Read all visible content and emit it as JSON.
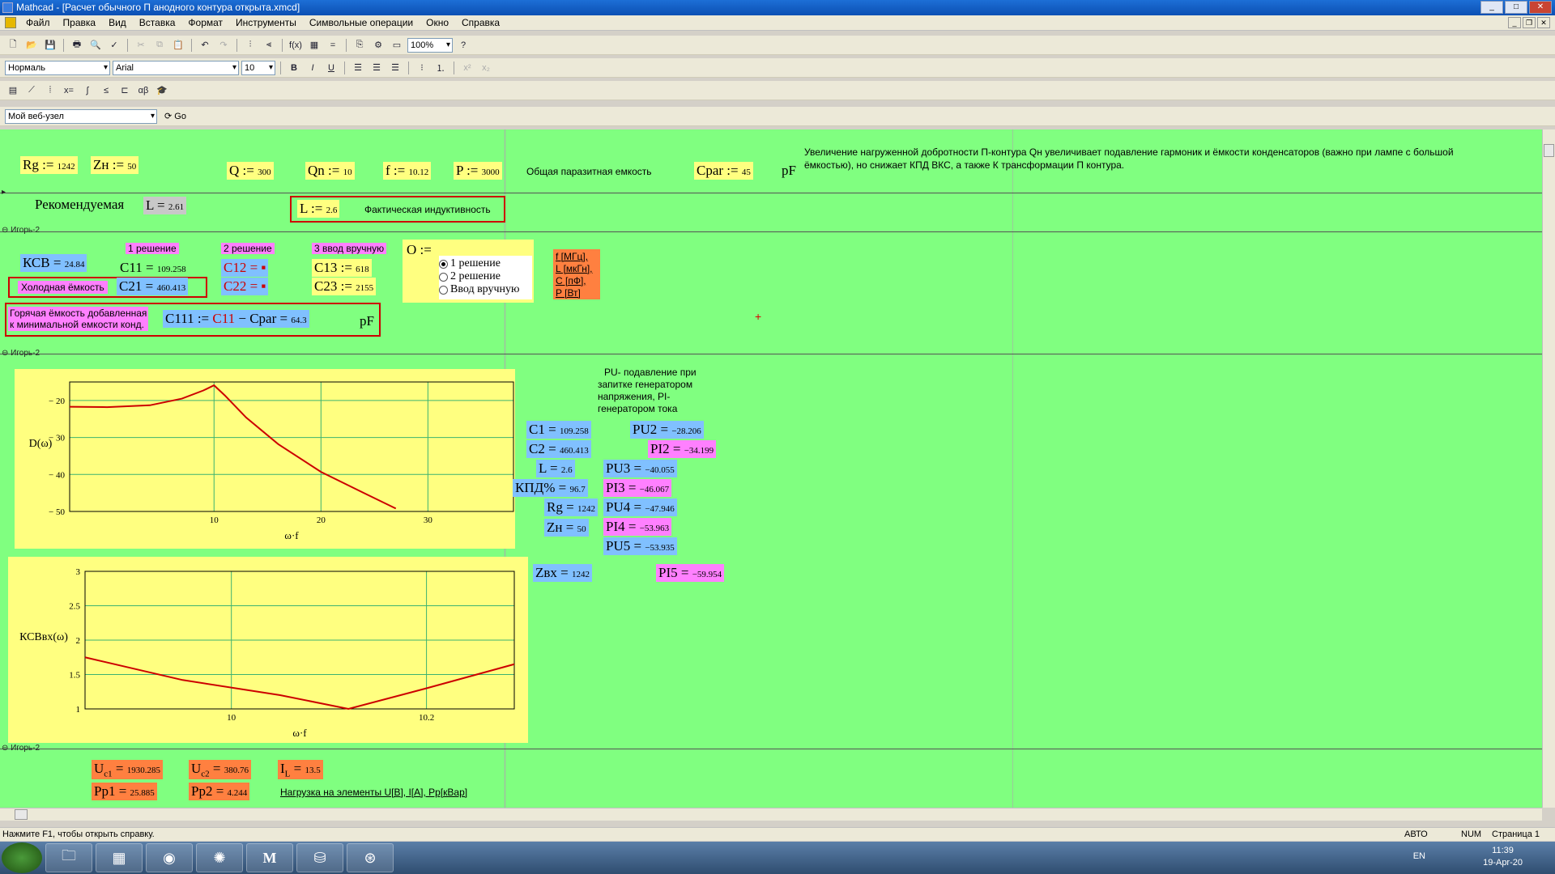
{
  "window": {
    "title": "Mathcad - [Расчет обычного П анодного контура открыта.xmcd]"
  },
  "menu": [
    "Файл",
    "Правка",
    "Вид",
    "Вставка",
    "Формат",
    "Инструменты",
    "Символьные операции",
    "Окно",
    "Справка"
  ],
  "toolbar": {
    "zoom": "100%",
    "style": "Нормаль",
    "font": "Arial",
    "size": "10",
    "web": "Мой веб-узел",
    "go": "Go"
  },
  "region_label": "Игорь-2",
  "top": {
    "rg_lhs": "Rg",
    "rg_val": "1242",
    "zn_lhs": "Zн",
    "zn_val": "50",
    "q_lhs": "Q",
    "q_val": "300",
    "qn_lhs": "Qn",
    "qn_val": "10",
    "f_lhs": "f",
    "f_val": "10.12",
    "p_lhs": "P",
    "p_val": "3000",
    "cpar_text": "Общая паразитная емкость",
    "cpar_lhs": "Cpar",
    "cpar_val": "45",
    "pf": "pF",
    "note": "Увеличение нагруженной добротности П-контура Qн увеличивает подавление гармоник и ёмкости конденсаторов (важно при лампе с большой ёмкостью), но снижает КПД ВКС, а также К трансформации П контура.",
    "rec": "Рекомендуемая",
    "l_rec_lhs": "L",
    "l_rec_val": "2.61",
    "l_act_lhs": "L",
    "l_act_val": "2.6",
    "l_act_text": "Фактическая индуктивность"
  },
  "mid": {
    "sol1": "1 решение",
    "sol2": "2 решение",
    "sol3": "3 ввод вручную",
    "ksv_lhs": "КСВ",
    "ksv_val": "24.84",
    "c11_lhs": "C11",
    "c11_val": "109.258",
    "c21_lhs": "C21",
    "c21_val": "460.413",
    "c12_lhs": "C12",
    "c22_lhs": "C22",
    "c13_lhs": "C13",
    "c13_val": "618",
    "c23_lhs": "C23",
    "c23_val": "2155",
    "cold": "Холодная ёмкость",
    "hot1": "Горячая ёмкость добавленная",
    "hot2": "к минимальной емкости конд.",
    "c111_lhs": "C111",
    "c111_op": ":=",
    "c111_a": "C11",
    "c111_minus": "−",
    "c111_b": "Cpar",
    "c111_val": "64.3",
    "pf": "pF",
    "o_lhs": "O :=",
    "opt": [
      "1 решение",
      "2 решение",
      "Ввод вручную"
    ],
    "units": [
      "f [МГц],",
      "L [мкГн],",
      "C [пФ],",
      "P [Вт]"
    ]
  },
  "results": {
    "pu_note": [
      "PU- подавление при",
      "запитке генератором",
      "напряжения, PI-",
      "генератором тока"
    ],
    "c1": "109.258",
    "c2": "460.413",
    "l": "2.6",
    "kpd": "96.7",
    "rg": "1242",
    "zn": "50",
    "zvx": "1242",
    "pu2": "−28.206",
    "pi2": "−34.199",
    "pu3": "−40.055",
    "pi3": "−46.067",
    "pu4": "−47.946",
    "pi4": "−53.963",
    "pu5": "−53.935",
    "pi5": "−59.954"
  },
  "bottom": {
    "uc1": "1930.285",
    "uc2": "380.76",
    "il": "13.5",
    "pp1": "25.885",
    "pp2": "4.244",
    "note": "Нагрузка на элементы U[В], I[A], Pp[кВар]"
  },
  "status": {
    "help": "Нажмите F1, чтобы открыть справку.",
    "auto": "АВТО",
    "num": "NUM",
    "page": "Страница 1"
  },
  "taskbar": {
    "lang": "EN",
    "time": "11:39",
    "date": "19-Apr-20"
  },
  "chart_data": [
    {
      "type": "line",
      "ylabel": "D(ω)",
      "xlabel": "ω·f",
      "xlim": [
        -3.5,
        38
      ],
      "ylim": [
        -50,
        -15
      ],
      "xticks": [
        10,
        20,
        30
      ],
      "yticks": [
        -20,
        -30,
        -40,
        -50
      ],
      "x": [
        -3.5,
        0,
        4,
        7,
        9,
        10,
        11,
        13,
        16,
        20,
        24,
        27
      ],
      "y": [
        -21.7,
        -21.8,
        -21.3,
        -19.5,
        -17.3,
        -15.9,
        -18.6,
        -24.6,
        -31.8,
        -39.3,
        -45,
        -49.2
      ]
    },
    {
      "type": "line",
      "ylabel": "КСВвх(ω)",
      "xlabel": "ω·f",
      "xlim": [
        9.85,
        10.29
      ],
      "ylim": [
        1,
        3
      ],
      "xticks": [
        10,
        10.2
      ],
      "yticks": [
        1,
        1.5,
        2,
        2.5,
        3
      ],
      "x": [
        9.85,
        9.95,
        10.05,
        10.12,
        10.2,
        10.29
      ],
      "y": [
        1.75,
        1.42,
        1.2,
        1.0,
        1.3,
        1.65
      ]
    }
  ]
}
